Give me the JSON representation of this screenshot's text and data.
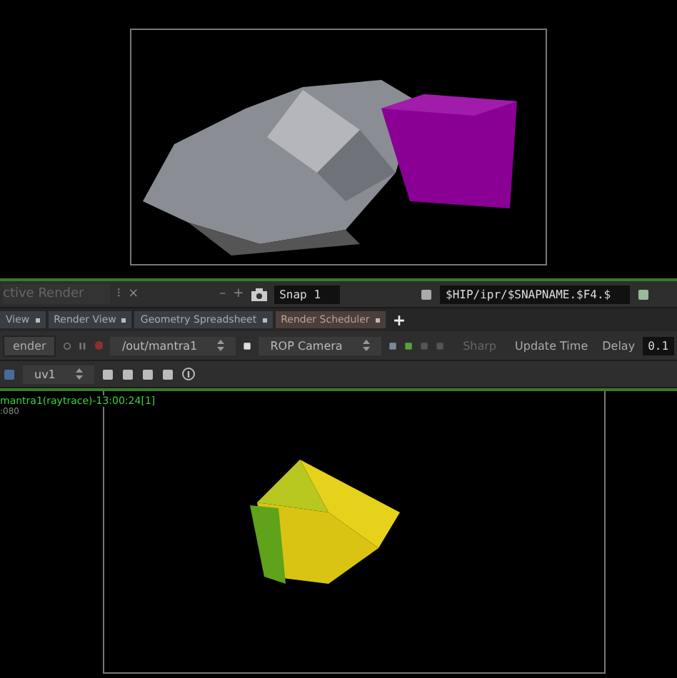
{
  "pane_bar": {
    "title": "ctive Render",
    "menu_glyph": "⁝",
    "close_glyph": "×",
    "minus_glyph": "–",
    "plus_glyph": "+",
    "snapshot": "Snap 1",
    "path": "$HIP/ipr/$SNAPNAME.$F4.$"
  },
  "tabs": [
    {
      "label": "View",
      "selected": false
    },
    {
      "label": "Render View",
      "selected": false
    },
    {
      "label": "Geometry Spreadsheet",
      "selected": false
    },
    {
      "label": "Render Scheduler",
      "selected": true
    }
  ],
  "add_tab": "+",
  "toolbar": {
    "render_button": "ender",
    "output": "/out/mantra1",
    "camera": "ROP Camera",
    "filter": {
      "label": "Sharp",
      "disabled": true
    },
    "update": "Update Time",
    "delay_label": "Delay",
    "delay_value": "0.1"
  },
  "toolbar2": {
    "aov": "uv1"
  },
  "render": {
    "status": "mantra1(raytrace)-13:00:24[1]",
    "status_line2": ":080"
  }
}
